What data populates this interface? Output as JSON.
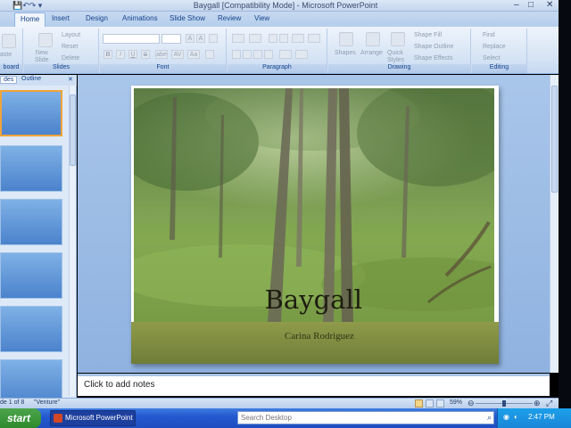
{
  "window": {
    "title": "Baygall [Compatibility Mode] - Microsoft PowerPoint",
    "quick_access_icon": "save-icon",
    "controls": [
      "minimize-icon",
      "maximize-icon",
      "close-icon"
    ]
  },
  "ribbon_tabs": [
    "Home",
    "Insert",
    "Design",
    "Animations",
    "Slide Show",
    "Review",
    "View"
  ],
  "active_tab": "Home",
  "ribbon": {
    "clipboard": {
      "label": "board",
      "paste": "aste"
    },
    "slides": {
      "label": "Slides",
      "new_slide": "New\nSlide",
      "layout": "Layout",
      "reset": "Reset",
      "delete": "Delete"
    },
    "font": {
      "label": "Font",
      "bold": "B",
      "italic": "I",
      "underline": "U",
      "strike": "S",
      "shadow": "abe",
      "spacing": "AV",
      "case": "Aa",
      "grow": "A",
      "shrink": "A"
    },
    "paragraph": {
      "label": "Paragraph"
    },
    "drawing": {
      "label": "Drawing",
      "shapes": "Shapes",
      "arrange": "Arrange",
      "quick_styles": "Quick\nStyles",
      "shape_fill": "Shape Fill",
      "shape_outline": "Shape Outline",
      "shape_effects": "Shape Effects"
    },
    "editing": {
      "label": "Editing",
      "find": "Find",
      "replace": "Replace",
      "select": "Select"
    }
  },
  "pane": {
    "tabs": [
      "des",
      "Outline"
    ],
    "thumb_count": 6
  },
  "slide": {
    "title": "Baygall",
    "subtitle": "Carina Rodriguez"
  },
  "notes": {
    "placeholder": "Click to add notes"
  },
  "status": {
    "slide_info": "de 1 of 8",
    "theme": "\"Venture\"",
    "zoom": "59%"
  },
  "taskbar": {
    "start": "start",
    "task_item": "Microsoft PowerPoint ...",
    "search_placeholder": "Search Desktop",
    "clock": "2:47 PM"
  },
  "colors": {
    "ribbon": "#d5e3f4",
    "slide_band": "#7b8840",
    "taskbar": "#2459cf",
    "start_green": "#3c993b"
  }
}
